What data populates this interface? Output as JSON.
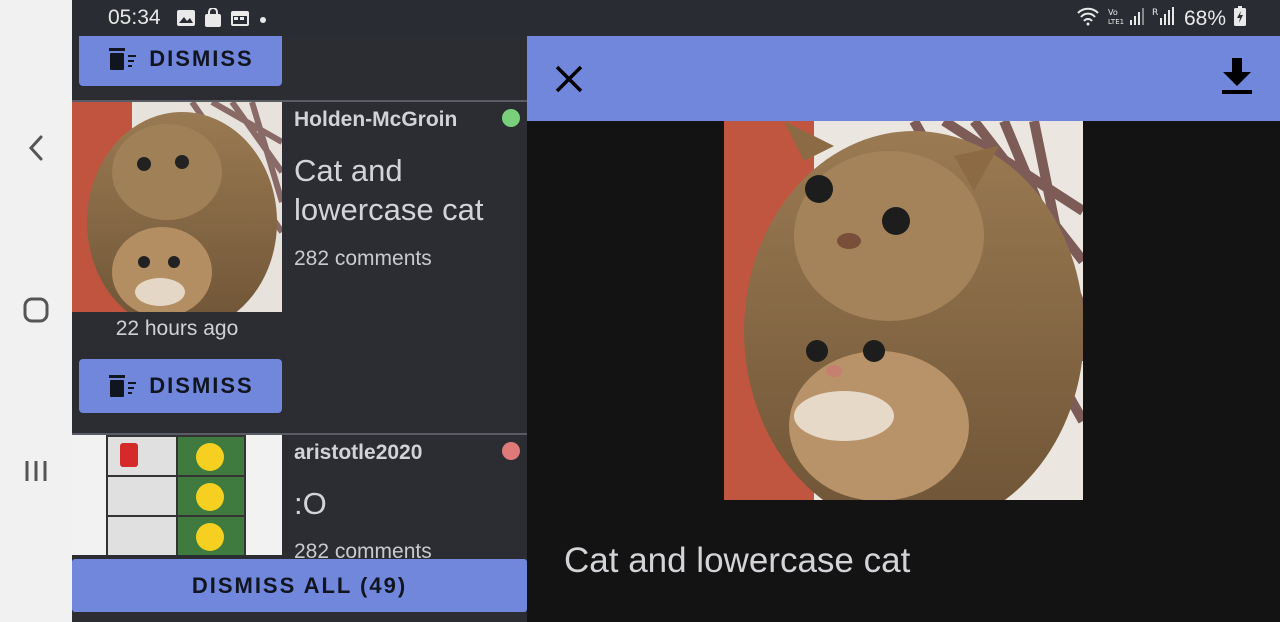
{
  "status_bar": {
    "time": "05:34",
    "battery": "68%",
    "left_icons": [
      "gallery-icon",
      "bag-icon",
      "calendar-icon",
      "dot-icon"
    ],
    "right_icons": [
      "wifi-icon",
      "volte-signal-icon",
      "roaming-signal-icon",
      "battery-icon"
    ]
  },
  "nav": {
    "icons": [
      "back-icon",
      "home-icon",
      "recents-icon"
    ]
  },
  "feed": {
    "top_dismiss_label": "DISMISS",
    "posts": [
      {
        "user": "Holden-McGroin",
        "status_color": "#7ad07a",
        "title": "Cat and lowercase cat",
        "comments": "282 comments",
        "age": "22 hours ago",
        "dismiss_label": "DISMISS"
      },
      {
        "user": "aristotle2020",
        "status_color": "#e07a7a",
        "title": ":O",
        "comments": "282 comments"
      }
    ],
    "dismiss_all_label": "DISMISS ALL (49)"
  },
  "viewer": {
    "caption": "Cat and lowercase cat",
    "icons": [
      "close-icon",
      "download-icon"
    ]
  },
  "colors": {
    "accent": "#7187dc",
    "panel": "#2b2d33",
    "viewer_bg": "#131313"
  }
}
